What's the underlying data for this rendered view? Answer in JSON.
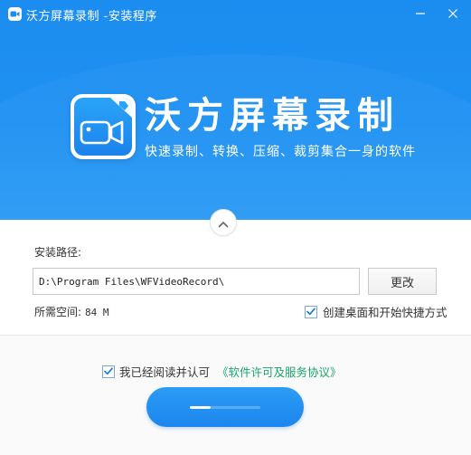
{
  "window": {
    "title": "沃方屏幕录制 -安装程序"
  },
  "brand": {
    "name": "沃方屏幕录制",
    "tagline": "快速录制、转换、压缩、裁剪集合一身的软件"
  },
  "install": {
    "path_label": "安装路径:",
    "path_value": "D:\\Program Files\\WFVideoRecord\\",
    "change_button": "更改",
    "space_label": "所需空间:",
    "space_value": "84 M",
    "shortcut_label": "创建桌面和开始快捷方式",
    "shortcut_checked": true
  },
  "agreement": {
    "label": "我已经阅读并认可",
    "link": "《软件许可及服务协议》",
    "checked": true
  },
  "install_button": {
    "progress": 0.3
  },
  "icons": {
    "app": "video-camera-icon",
    "minimize": "minimize-icon",
    "close": "close-icon",
    "collapse": "chevron-up-icon",
    "checkbox": "check-icon"
  },
  "colors": {
    "header": "#1c8df0",
    "accent": "#1b86ee",
    "link": "#1aa56b",
    "check": "#1a7fd6"
  }
}
